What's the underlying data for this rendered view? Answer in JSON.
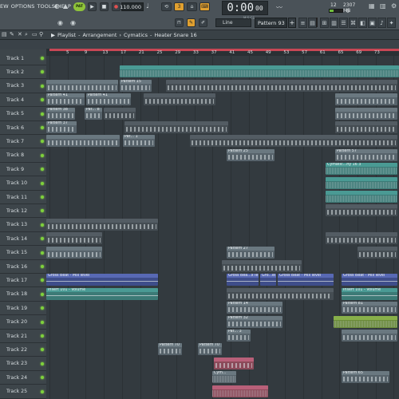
{
  "menu": [
    "EW",
    "OPTIONS",
    "TOOLS",
    "HELP"
  ],
  "toolbar": {
    "pat_label": "PAT",
    "tempo": "110.000",
    "time": "0:00",
    "time_small": "00",
    "time_unit": "M:S:CS",
    "cpu_num": "12",
    "mem_label": "2307 MB",
    "cpu_val": "0",
    "snap": "Line",
    "pattern": "Pattern 93",
    "pattern_add": "+"
  },
  "playlist": {
    "breadcrumb": [
      "Playlist",
      "Arrangement",
      "Cymatics",
      "Heater Snare 16"
    ],
    "ruler": [
      "5",
      "9",
      "13",
      "17",
      "21",
      "25",
      "29",
      "33",
      "37",
      "41",
      "45",
      "49",
      "53",
      "57",
      "61",
      "65",
      "69",
      "73"
    ]
  },
  "tracks": [
    "Track 1",
    "Track 2",
    "Track 3",
    "Track 4",
    "Track 5",
    "Track 6",
    "Track 7",
    "Track 8",
    "Track 9",
    "Track 10",
    "Track 11",
    "Track 12",
    "Track 13",
    "Track 14",
    "Track 15",
    "Track 16",
    "Track 17",
    "Track 18",
    "Track 19",
    "Track 20",
    "Track 21",
    "Track 22",
    "Track 23",
    "Track 24",
    "Track 25"
  ],
  "clips": {
    "pattern15": "Pattern 15",
    "pattern41a": "Pattern 41",
    "pattern41b": "Pattern 41",
    "pattern38": "Pattern 38",
    "pat8": "Pat... 8",
    "pattern37": "Pattern 37",
    "pat1": "Pat... 1",
    "pattern57": "Pattern 57",
    "pattern25": "Pattern 25",
    "cymatic": "Cymatic...ny 16 3",
    "gross1": "Gross Beat - Mix level",
    "gross2": "Gross Bea...x level",
    "gross3": "Gro...el",
    "gross4": "Gross Beat - Mix level",
    "gross5": "Gross Beat - Mix level",
    "insert1": "Insert 101 - Volume",
    "insert2": "Insert 101 - Volume",
    "pattern81": "Pattern 81",
    "pattern70a": "Pattern 70",
    "pattern70b": "Pattern 70",
    "pattern27": "Pattern 27",
    "pattern14": "Pattern 14",
    "pattern32": "Pattern 32",
    "pat3": "Pat... 3",
    "cym": "Cym...",
    "pattern65": "Pattern 65"
  }
}
